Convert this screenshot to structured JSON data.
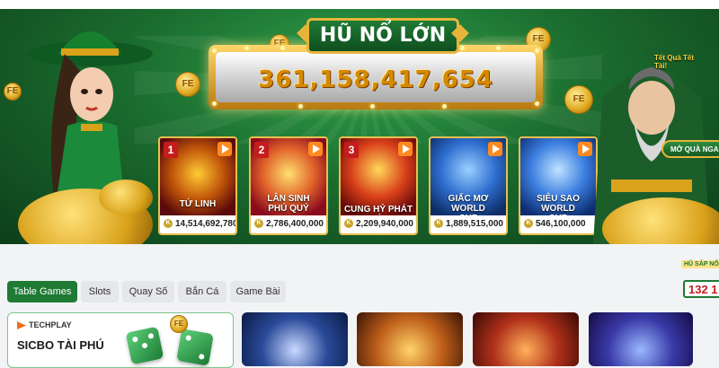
{
  "jackpot": {
    "title": "HŨ NỔ LỚN",
    "value": "361,158,417,654"
  },
  "jackpot_games": [
    {
      "rank": "1",
      "name": "TỨ LINH",
      "amount": "14,514,692,780"
    },
    {
      "rank": "2",
      "name": "LÂN SINH PHÚ QUÝ",
      "amount": "2,786,400,000"
    },
    {
      "rank": "3",
      "name": "CUNG HỶ PHÁT TÀI",
      "amount": "2,209,940,000"
    },
    {
      "rank": "",
      "name": "GIẤC MƠ WORLD CUP",
      "amount": "1,889,515,000"
    },
    {
      "rank": "",
      "name": "SIÊU SAO WORLD CUP",
      "amount": "546,100,000"
    }
  ],
  "coin_symbol": "K",
  "coin_text": "FE",
  "gift": {
    "label": "Tết Quà Tết Tài!",
    "button": "MỞ QUÀ NGA"
  },
  "category_tabs": [
    {
      "label": "Table Games",
      "active": true
    },
    {
      "label": "Slots",
      "active": false
    },
    {
      "label": "Quay Số",
      "active": false
    },
    {
      "label": "Bắn Cá",
      "active": false
    },
    {
      "label": "Game Bài",
      "active": false
    }
  ],
  "featured": {
    "provider": "TECHPLAY",
    "game": "SICBO TÀI PHÚ"
  },
  "hot_badge": {
    "label": "HŨ SẮP NỔ",
    "number": "132 1"
  },
  "colors": {
    "brand_green": "#1f7a34",
    "gold": "#e7b43a",
    "rank_red": "#c41d1d"
  }
}
